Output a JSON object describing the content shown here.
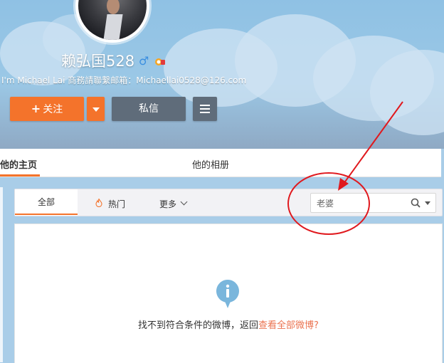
{
  "profile": {
    "name": "赖弘国528",
    "gender_icon": "male-icon",
    "badge_icon": "member-badge-icon",
    "bio": "I'm Michael Lai 商務請聯繫邮箱：Michaellai0528@126.com",
    "avatar_icon": "avatar"
  },
  "actions": {
    "follow_label": "关注",
    "message_label": "私信"
  },
  "tabs": {
    "home_label": "他的主页",
    "album_label": "他的相册"
  },
  "filter": {
    "all_label": "全部",
    "hot_label": "热门",
    "more_label": "更多",
    "search_value": "老婆"
  },
  "empty": {
    "message": "找不到符合条件的微博，返回",
    "link": "查看全部微博?"
  },
  "colors": {
    "accent": "#f4732b",
    "secondary_button": "#5f6c7a",
    "link": "#eb7350",
    "annotation": "#e0191e"
  }
}
